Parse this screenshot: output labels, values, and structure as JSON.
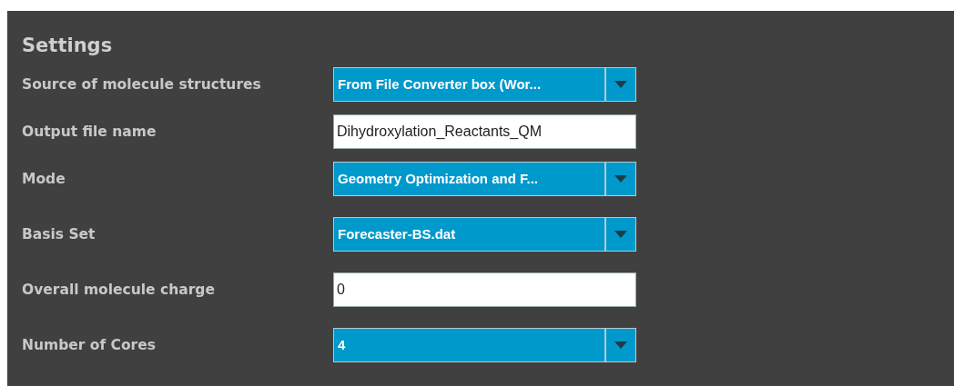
{
  "panel": {
    "title": "Settings"
  },
  "fields": [
    {
      "kind": "dropdown",
      "label": "Source of molecule structures",
      "value": "From File Converter box (Wor..."
    },
    {
      "kind": "text",
      "label": "Output file name",
      "value": "Dihydroxylation_Reactants_QM"
    },
    {
      "kind": "dropdown",
      "label": "Mode",
      "value": "Geometry Optimization and F..."
    },
    {
      "kind": "dropdown",
      "label": "Basis Set",
      "value": "Forecaster-BS.dat"
    },
    {
      "kind": "text",
      "label": "Overall molecule charge",
      "value": "0"
    },
    {
      "kind": "dropdown",
      "label": "Number of Cores",
      "value": "4"
    }
  ]
}
